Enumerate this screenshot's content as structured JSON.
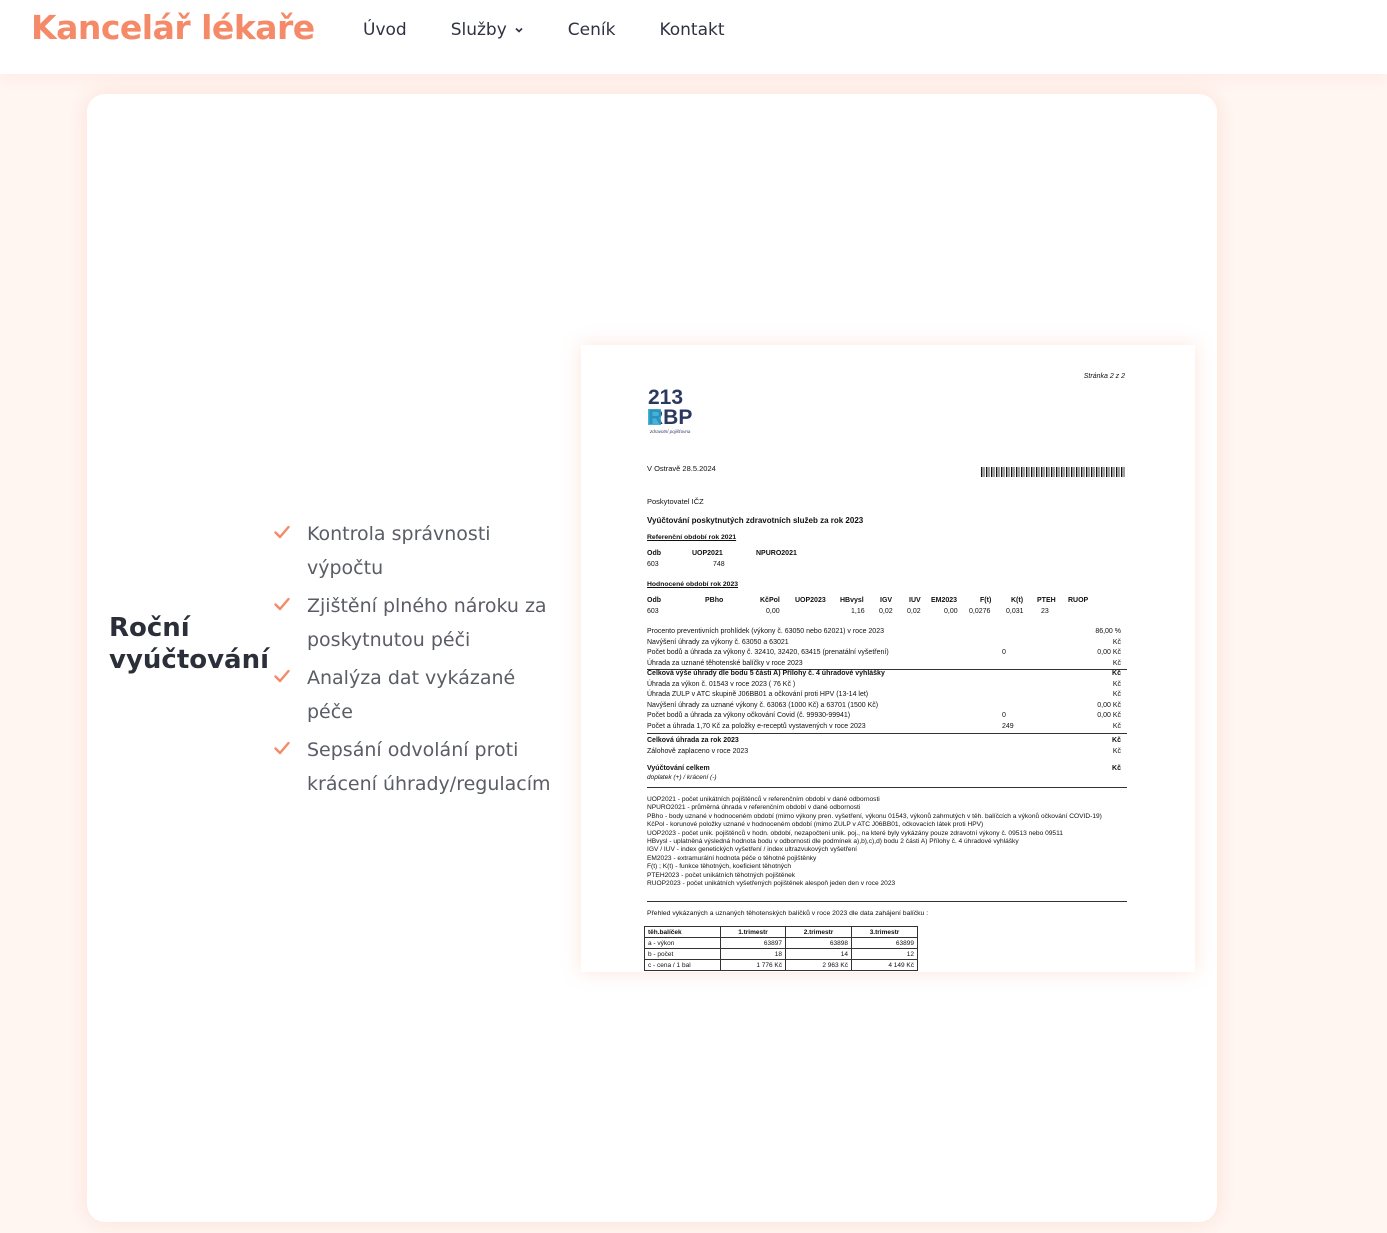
{
  "brand": "Kancelář lékaře",
  "menu": [
    {
      "label": "Úvod"
    },
    {
      "label": "Služby"
    },
    {
      "label": "Ceník"
    },
    {
      "label": "Kontakt"
    }
  ],
  "section": {
    "title": "Roční vyúčtování",
    "features": [
      "Kontrola správnosti výpočtu",
      "Zjištění plného nároku za poskytnutou péči",
      "Analýza dat vykázané péče",
      "Sepsání odvolání proti krácení úhrady/regulacím"
    ]
  },
  "document": {
    "page": "Stránka 2 z 2",
    "logo_top": "213",
    "logo_bottom": "RBP",
    "logo_sub": "zdravotní pojišťovna",
    "place_date": "V Ostravě  28.5.2024",
    "provider": "Poskytovatel  IČZ",
    "heading": "Vyúčtování poskytnutých zdravotních služeb za rok 2023",
    "ref_title": "Referenční období rok 2021",
    "ref_cols": [
      "Odb",
      "UOP2021",
      "NPURO2021"
    ],
    "ref_vals": [
      "603",
      "748"
    ],
    "eval_title": "Hodnocené období rok 2023",
    "eval_cols": [
      "Odb",
      "PBho",
      "KčPol",
      "UOP2023",
      "HBvysl",
      "IGV",
      "IUV",
      "EM2023",
      "F(t)",
      "K(t)",
      "PTEH",
      "RUOP"
    ],
    "eval_vals": [
      "603",
      "0,00",
      "1,16",
      "0,02",
      "0,02",
      "0,00",
      "0,0276",
      "0,031",
      "23"
    ],
    "lines": [
      {
        "text": "Procento preventivních prohlídek (výkony č. 63050 nebo 62021) v roce 2023",
        "mid": "",
        "right": "86,00 %",
        "bold": false
      },
      {
        "text": "Navýšení úhrady za výkony č. 63050 a 63021",
        "mid": "",
        "right": "Kč",
        "bold": false
      },
      {
        "text": "Počet bodů a úhrada za výkony č. 32410, 32420, 63415 (prenatální vyšetření)",
        "mid": "0",
        "right": "0,00 Kč",
        "bold": false
      },
      {
        "text": "Úhrada za uznané těhotenské balíčky v roce 2023",
        "mid": "",
        "right": "Kč",
        "bold": false
      },
      {
        "text": "Celková výše úhrady dle bodu 5 části A) Přílohy č. 4 úhradové vyhlášky",
        "mid": "",
        "right": "Kč",
        "bold": true
      },
      {
        "text": "Úhrada za výkon č. 01543 v roce 2023 ( 76 Kč )",
        "mid": "",
        "right": "Kč",
        "bold": false
      },
      {
        "text": "Úhrada ZULP v ATC skupině J06BB01 a očkování proti HPV (13-14 let)",
        "mid": "",
        "right": "Kč",
        "bold": false
      },
      {
        "text": "Navýšení úhrady za uznané výkony č. 63063 (1000 Kč) a 63701 (1500 Kč)",
        "mid": "",
        "right": "0,00 Kč",
        "bold": false
      },
      {
        "text": "Počet bodů a úhrada za výkony očkování Covid (č. 99930-99941)",
        "mid": "0",
        "right": "0,00 Kč",
        "bold": false
      },
      {
        "text": "Počet a úhrada 1,70 Kč za položky e-receptů vystavených v roce 2023",
        "mid": "249",
        "right": "Kč",
        "bold": false
      }
    ],
    "total_title": "Celková úhrada za rok 2023",
    "total_right": "Kč",
    "advance": "Zálohově zaplaceno v roce 2023",
    "advance_right": "Kč",
    "settlement_title": "Vyúčtování celkem",
    "settlement_sub": "doplatek (+) / krácení (-)",
    "settlement_right": "Kč",
    "legend": [
      "UOP2021 - počet unikátních pojištěnců v referenčním období v dané odbornosti",
      "NPURO2021 - průměrná úhrada v referenčním období v dané odbornosti",
      "PBho - body uznané v hodnoceném období (mimo výkony pren. vyšetření, výkonu 01543, výkonů zahrnutých v těh. balíčcích a výkonů očkování COVID-19)",
      "KčPol - korunové položky uznané v hodnoceném období (mimo ZULP v ATC J06BB01, očkovacích látek proti HPV)",
      "UOP2023 - počet unik. pojištěnců v hodn. období, nezapočteni unik. poj., na které byly vykázány pouze zdravotní výkony č. 09513 nebo 09511",
      "HBvysl - uplatněná výsledná hodnota bodu v odbornosti dle podmínek a),b),c),d) bodu 2 části A) Přílohy č. 4 úhradové vyhlášky",
      "IGV / IUV - index genetických vyšetření / index ultrazvukových vyšetření",
      "EM2023 - extramurální hodnota péče o těhotné pojištěnky",
      "F(t) ; K(t) - funkce těhotných, koeficient těhotných",
      "PTEH2023 - počet unikátních těhotných pojištěnek",
      "RUOP2023 - počet unikátních vyšetřených pojištěnek alespoň jeden den v roce 2023"
    ],
    "overview": "Přehled vykázaných a uznaných těhotenských balíčků v roce 2023 dle data zahájení balíčku :",
    "table": {
      "headers": [
        "těh.balíček",
        "1.trimestr",
        "2.trimestr",
        "3.trimestr"
      ],
      "rows": [
        [
          "a - výkon",
          "63897",
          "63898",
          "63899"
        ],
        [
          "b - počet",
          "18",
          "14",
          "12"
        ],
        [
          "c - cena / 1 bal",
          "1 776 Kč",
          "2 963 Kč",
          "4 149 Kč"
        ]
      ]
    }
  }
}
